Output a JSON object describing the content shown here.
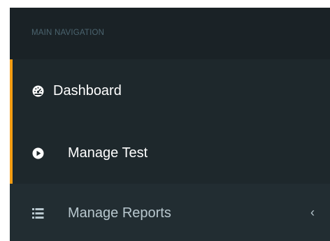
{
  "sidebar": {
    "section_header": "MAIN NAVIGATION",
    "items": [
      {
        "label": "Dashboard",
        "icon": "dashboard-icon",
        "active": true
      },
      {
        "label": "Manage Test",
        "icon": "play-circle-icon",
        "active": true
      },
      {
        "label": "Manage Reports",
        "icon": "list-icon",
        "active": false,
        "expand_icon": "chevron-left-icon"
      }
    ]
  },
  "colors": {
    "sidebar_bg": "#222d32",
    "header_bg": "#1a2226",
    "active_bg": "#1e282c",
    "accent": "#f39c12",
    "header_text": "#4b646f",
    "item_text": "#ffffff",
    "muted_text": "#b8c7ce"
  }
}
